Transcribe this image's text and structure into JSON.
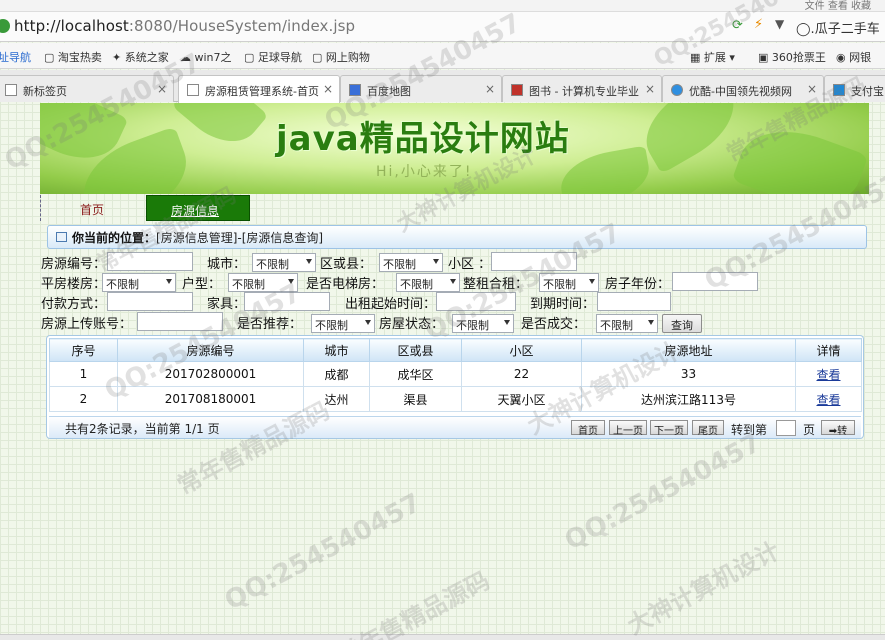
{
  "browser": {
    "menu_partial": "文件    查看    收藏",
    "url_host": "http://localhost",
    "url_rest": ":8080/HouseSystem/index.jsp",
    "right_search": "瓜子二手车",
    "bookmarks": [
      "址导航",
      "淘宝热卖",
      "系统之家",
      "win7之",
      "足球导航",
      "网上购物",
      "扩展",
      "360抢票王",
      "网银"
    ],
    "tabs": [
      "新标签页",
      "房源租赁管理系统-首页",
      "百度地图",
      "图书 - 计算机专业毕业",
      "优酷-中国领先视频网",
      "支付宝"
    ]
  },
  "banner": {
    "title": "java精品设计网站",
    "subtitle": "Hi,小心来了!"
  },
  "nav": {
    "home": "首页",
    "house_info": "房源信息"
  },
  "location": {
    "label": "你当前的位置：",
    "path": "[房源信息管理]-[房源信息查询]"
  },
  "filters": {
    "house_no": "房源编号：",
    "city": "城市：",
    "district": "区或县：",
    "community": "小区 ：",
    "flat_floor": "平房楼房：",
    "layout": "户型：",
    "elevator": "是否电梯房：",
    "rent_type": "整租合租：",
    "house_age": "房子年份：",
    "payment": "付款方式：",
    "furniture": "家具：",
    "rent_start": "出租起始时间：",
    "expire": "到期时间：",
    "uploader": "房源上传账号：",
    "recommend": "是否推荐：",
    "status": "房屋状态：",
    "deal": "是否成交：",
    "unlimited": "不限制",
    "search_button": "查询"
  },
  "table": {
    "headers": [
      "序号",
      "房源编号",
      "城市",
      "区或县",
      "小区",
      "房源地址",
      "详情"
    ],
    "rows": [
      [
        "1",
        "201702800001",
        "成都",
        "成华区",
        "22",
        "33",
        "查看"
      ],
      [
        "2",
        "201708180001",
        "达州",
        "渠县",
        "天翼小区",
        "达州滨江路113号",
        "查看"
      ]
    ],
    "summary": "共有2条记录，当前第 1/1 页",
    "pager": [
      "首页",
      "上一页",
      "下一页",
      "尾页"
    ],
    "goto": "转到第",
    "page_unit": "页",
    "go_button": "➡转"
  },
  "watermarks": [
    "QQ:254540457",
    "常年售精品源码",
    "大神计算机设计"
  ]
}
